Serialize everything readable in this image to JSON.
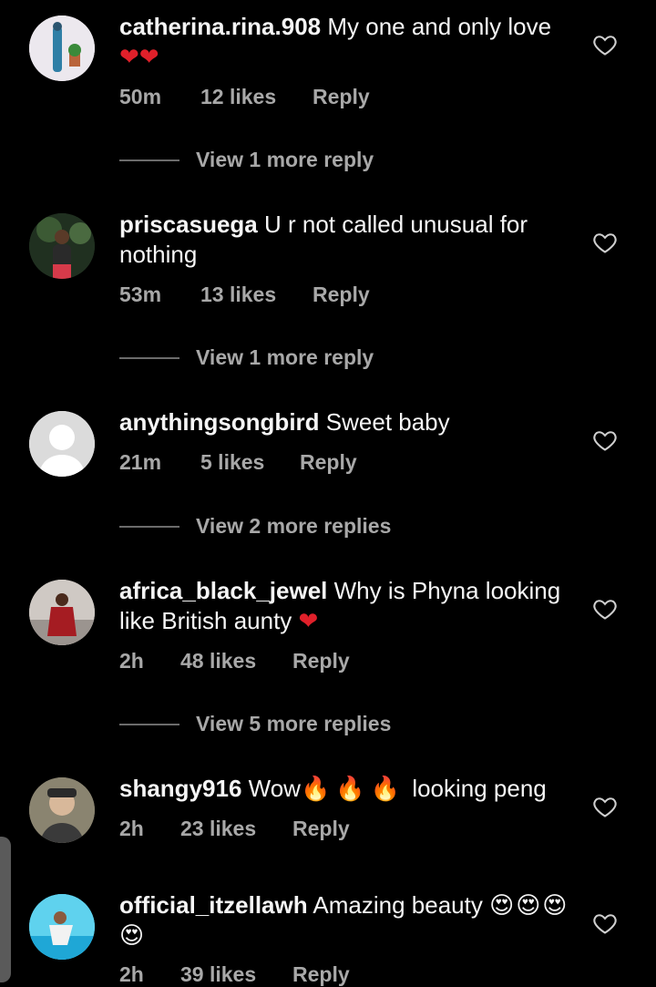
{
  "comments": [
    {
      "username": "catherina.rina.908",
      "text": "My one and only love",
      "emoji": "❤❤",
      "time": "50m",
      "likes": "12 likes",
      "reply": "Reply",
      "view_more": "View 1 more reply"
    },
    {
      "username": "priscasuega",
      "text": "U r not called unusual for nothing",
      "time": "53m",
      "likes": "13 likes",
      "reply": "Reply",
      "view_more": "View 1 more reply"
    },
    {
      "username": "anythingsongbird",
      "text": "Sweet baby",
      "time": "21m",
      "likes": "5 likes",
      "reply": "Reply",
      "view_more": "View 2 more replies"
    },
    {
      "username": "africa_black_jewel",
      "text": "Why is Phyna looking like British aunty",
      "emoji": "❤",
      "time": "2h",
      "likes": "48 likes",
      "reply": "Reply",
      "view_more": "View 5 more replies"
    },
    {
      "username": "shangy916",
      "text_before": "Wow",
      "emoji": "🔥🔥🔥",
      "text_after": "looking peng",
      "time": "2h",
      "likes": "23 likes",
      "reply": "Reply"
    },
    {
      "username": "official_itzellawh",
      "text": "Amazing beauty",
      "emoji": "😍😍😍😍",
      "time": "2h",
      "likes": "39 likes",
      "reply": "Reply"
    }
  ],
  "icons": {
    "like": "heart-outline-icon",
    "avatar_placeholder": "default-user-icon"
  }
}
